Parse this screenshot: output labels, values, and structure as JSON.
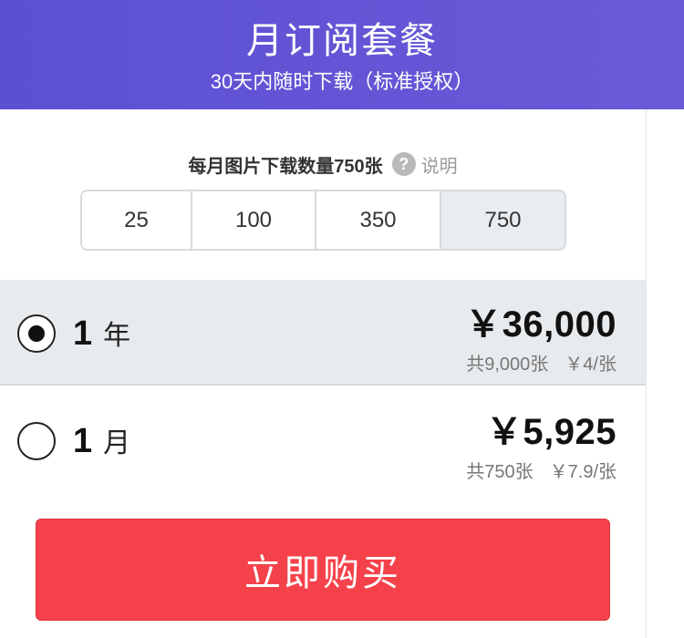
{
  "header": {
    "title": "月订阅套餐",
    "subtitle": "30天内随时下载（标准授权）"
  },
  "quantity": {
    "label": "每月图片下载数量750张",
    "help_icon": "question-circle-icon",
    "help_text": "说明",
    "options": [
      "25",
      "100",
      "350",
      "750"
    ],
    "selected": "750"
  },
  "plans": [
    {
      "count": "1",
      "unit": "年",
      "price": "￥36,000",
      "total": "共9,000张",
      "per_unit": "￥4/张",
      "selected": true
    },
    {
      "count": "1",
      "unit": "月",
      "price": "￥5,925",
      "total": "共750张",
      "per_unit": "￥7.9/张",
      "selected": false
    }
  ],
  "buy_button": {
    "label": "立即购买"
  },
  "colors": {
    "header_bg": "#5c50d2",
    "buy_bg": "#f5424a",
    "selected_row_bg": "#e8ebed"
  }
}
